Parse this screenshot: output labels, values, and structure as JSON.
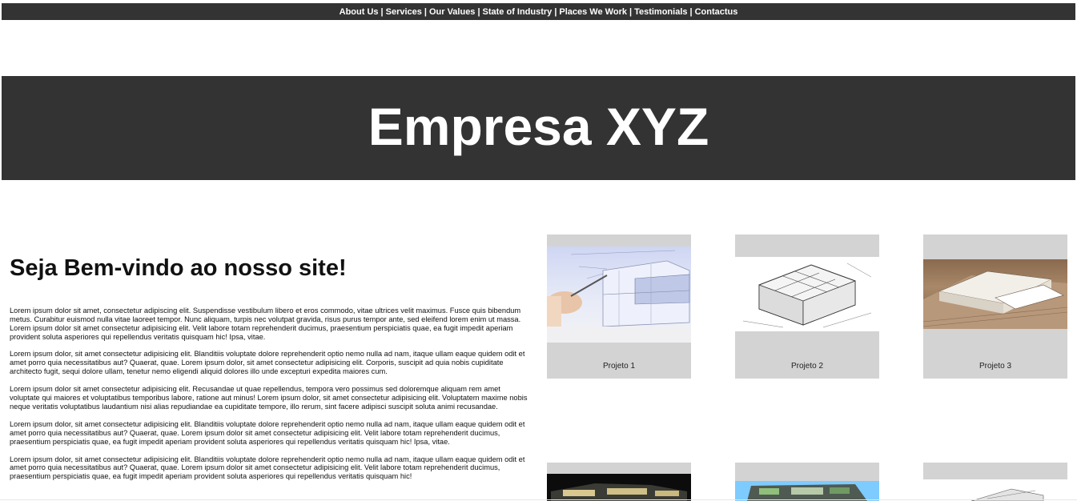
{
  "nav": {
    "items": [
      "About Us",
      "Services",
      "Our Values",
      "State of Industry",
      "Places We Work",
      "Testimonials",
      "Contactus"
    ],
    "separator": "|"
  },
  "banner": {
    "title": "Empresa XYZ"
  },
  "main": {
    "heading": "Seja Bem-vindo ao nosso site!",
    "paragraphs": [
      "Lorem ipsum dolor sit amet, consectetur adipiscing elit. Suspendisse vestibulum libero et eros commodo, vitae ultrices velit maximus. Fusce quis bibendum metus. Curabitur euismod nulla vitae laoreet tempor. Nunc aliquam, turpis nec volutpat gravida, risus purus tempor ante, sed eleifend lorem enim ut massa. Lorem ipsum dolor sit amet consectetur adipisicing elit. Velit labore totam reprehenderit ducimus, praesentium perspiciatis quae, ea fugit impedit aperiam provident soluta asperiores qui repellendus veritatis quisquam hic! Ipsa, vitae.",
      "Lorem ipsum dolor, sit amet consectetur adipisicing elit. Blanditiis voluptate dolore reprehenderit optio nemo nulla ad nam, itaque ullam eaque quidem odit et amet porro quia necessitatibus aut? Quaerat, quae. Lorem ipsum dolor, sit amet consectetur adipisicing elit. Corporis, suscipit ad quia nobis cupiditate architecto fugit, sequi dolore ullam, tenetur nemo eligendi aliquid dolores illo unde excepturi expedita maiores cum.",
      "Lorem ipsum dolor sit amet consectetur adipisicing elit. Recusandae ut quae repellendus, tempora vero possimus sed doloremque aliquam rem amet voluptate qui maiores et voluptatibus temporibus labore, ratione aut minus! Lorem ipsum dolor, sit amet consectetur adipisicing elit. Voluptatem maxime nobis neque veritatis voluptatibus laudantium nisi alias repudiandae ea cupiditate tempore, illo rerum, sint facere adipisci suscipit soluta animi recusandae.",
      "Lorem ipsum dolor, sit amet consectetur adipisicing elit. Blanditiis voluptate dolore reprehenderit optio nemo nulla ad nam, itaque ullam eaque quidem odit et amet porro quia necessitatibus aut? Quaerat, quae. Lorem ipsum dolor sit amet consectetur adipisicing elit. Velit labore totam reprehenderit ducimus, praesentium perspiciatis quae, ea fugit impedit aperiam provident soluta asperiores qui repellendus veritatis quisquam hic! Ipsa, vitae.",
      "Lorem ipsum dolor, sit amet consectetur adipisicing elit. Blanditiis voluptate dolore reprehenderit optio nemo nulla ad nam, itaque ullam eaque quidem odit et amet porro quia necessitatibus aut? Quaerat, quae. Lorem ipsum dolor sit amet consectetur adipisicing elit. Velit labore totam reprehenderit ducimus, praesentium perspiciatis quae, ea fugit impedit aperiam provident soluta asperiores qui repellendus veritatis quisquam hic!"
    ]
  },
  "projects": [
    {
      "label": "Projeto 1"
    },
    {
      "label": "Projeto 2"
    },
    {
      "label": "Projeto 3"
    }
  ]
}
